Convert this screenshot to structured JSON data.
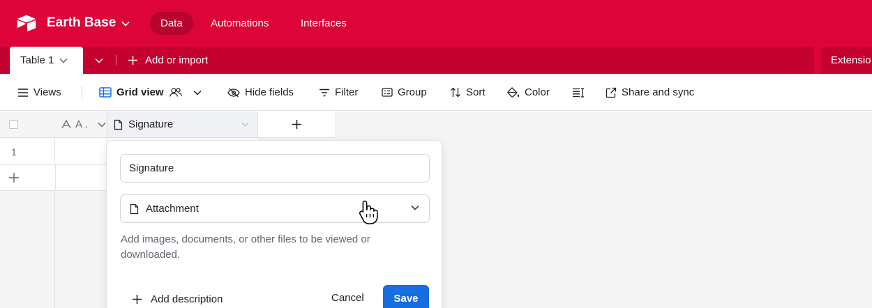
{
  "header": {
    "base_name": "Earth Base",
    "nav": [
      {
        "label": "Data",
        "active": true
      },
      {
        "label": "Automations",
        "active": false
      },
      {
        "label": "Interfaces",
        "active": false
      }
    ],
    "accent_color": "#dc0438"
  },
  "tabbar": {
    "table_tab": "Table 1",
    "add_import": "Add or import",
    "extensions": "Extensio"
  },
  "toolbar": {
    "views": "Views",
    "grid_view": "Grid view",
    "hide_fields": "Hide fields",
    "filter": "Filter",
    "group": "Group",
    "sort": "Sort",
    "color": "Color",
    "share_sync": "Share and sync"
  },
  "grid": {
    "columns": [
      {
        "label": "A .",
        "icon": "text-icon"
      },
      {
        "label": "Signature",
        "icon": "document-icon"
      }
    ],
    "rows": [
      {
        "number": "1"
      }
    ]
  },
  "field_editor": {
    "name_value": "Signature",
    "type": "Attachment",
    "type_icon": "document-icon",
    "description": "Add images, documents, or other files to be viewed or downloaded.",
    "add_description": "Add description",
    "cancel": "Cancel",
    "save": "Save",
    "save_color": "#166ee1"
  }
}
